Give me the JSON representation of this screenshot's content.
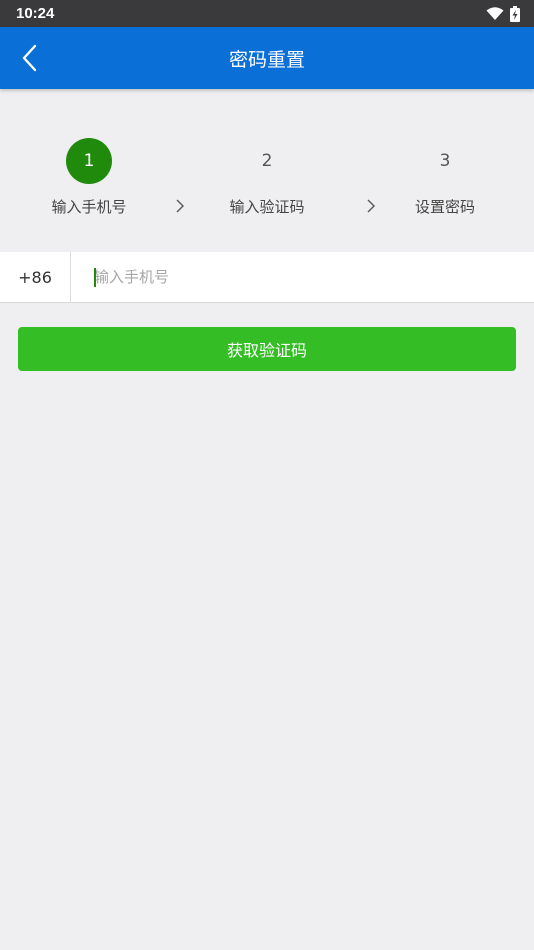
{
  "status_bar": {
    "time": "10:24",
    "icons": [
      "wifi-icon",
      "battery-charging-icon"
    ]
  },
  "app_bar": {
    "title": "密码重置",
    "back_icon": "chevron-left-icon",
    "background": "#0a6fd6"
  },
  "steps": [
    {
      "number": "1",
      "label": "输入手机号",
      "active": true
    },
    {
      "number": "2",
      "label": "输入验证码",
      "active": false
    },
    {
      "number": "3",
      "label": "设置密码",
      "active": false
    }
  ],
  "phone_input": {
    "country_code": "+86",
    "value": "",
    "placeholder": "输入手机号"
  },
  "get_code_button": {
    "label": "获取验证码",
    "color": "#35bd25"
  },
  "colors": {
    "active_step": "#1f8a0b",
    "page_background": "#efeff1"
  }
}
